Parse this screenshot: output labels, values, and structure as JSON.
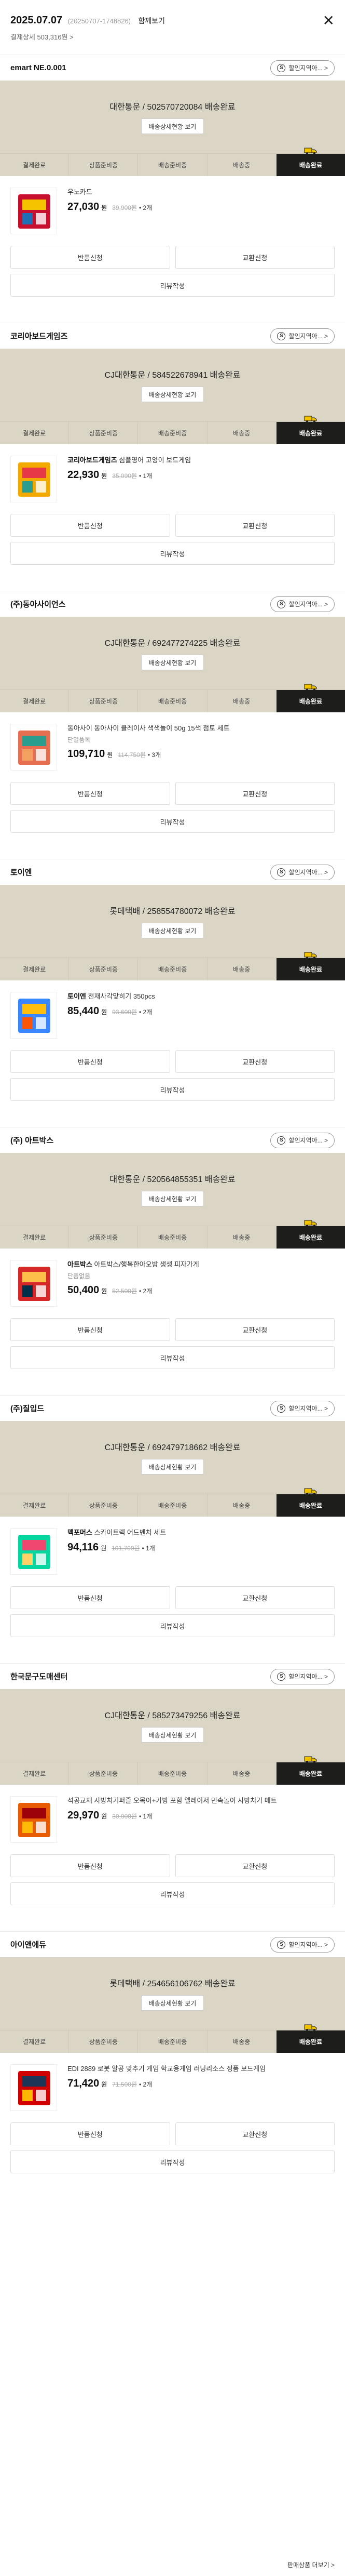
{
  "header": {
    "date": "2025.07.07",
    "order_no": "(20250707-1748826)",
    "all_link": "함께보기",
    "total": "결제상세 503,316원 >"
  },
  "steps": [
    "결제완료",
    "상품준비중",
    "배송준비중",
    "배송중",
    "배송완료"
  ],
  "ship_detail_label": "배송상세현황 보기",
  "return_label": "반품신청",
  "exchange_label": "교환신청",
  "review_label": "리뷰작성",
  "coupon_label": "할인지역아... >",
  "orders": [
    {
      "seller": "emart NE.0.001",
      "ship_status": "대한통운 / 502570720084 배송완료",
      "name_bold": "",
      "name": "우노카드",
      "option": "",
      "price": "27,030",
      "won": "원",
      "orig": "39,900원",
      "qty": "• 2개"
    },
    {
      "seller": "코리아보드게임즈",
      "ship_status": "CJ대한통운 / 584522678941 배송완료",
      "name_bold": "코리아보드게임즈",
      "name": " 심플영어 고양이 보드게임",
      "option": "",
      "price": "22,930",
      "won": "원",
      "orig": "35,090원",
      "qty": "• 1개"
    },
    {
      "seller": "(주)동아사이언스",
      "ship_status": "CJ대한통운 / 692477274225 배송완료",
      "name_bold": "",
      "name": "동아사이 동아사이 클레이사 색색놀이 50g 15색 점토 세트",
      "option": "단일품목",
      "price": "109,710",
      "won": "원",
      "orig": "114,750원",
      "qty": "• 3개"
    },
    {
      "seller": "토이엔",
      "ship_status": "롯데택배 / 258554780072 배송완료",
      "name_bold": "토이엔",
      "name": " 천재사각맞히기 350pcs",
      "option": "",
      "price": "85,440",
      "won": "원",
      "orig": "93,600원",
      "qty": "• 2개"
    },
    {
      "seller": "(주) 아트박스",
      "ship_status": "대한통운 / 520564855351 배송완료",
      "name_bold": "아트박스",
      "name": " 아트박스/행복한아오방 생생 피자가게",
      "option": "단품없음",
      "price": "50,400",
      "won": "원",
      "orig": "52,500원",
      "qty": "• 2개"
    },
    {
      "seller": "(주)질입드",
      "ship_status": "CJ대한통운 / 692479718662 배송완료",
      "name_bold": "맥포머스",
      "name": " 스카이트렉 어드벤처 세트",
      "option": "",
      "price": "94,116",
      "won": "원",
      "orig": "101,700원",
      "qty": "• 1개"
    },
    {
      "seller": "한국문구도매센터",
      "ship_status": "CJ대한통운 / 585273479256 배송완료",
      "name_bold": "",
      "name": "석공교재 사방치기퍼즐 오목이+가방 포함 엘레이저 민속놀이 사방치기 매트",
      "option": "",
      "price": "29,970",
      "won": "원",
      "orig": "30,000원",
      "qty": "• 1개"
    },
    {
      "seller": "아이앤에듀",
      "ship_status": "롯데택배 / 254656106762 배송완료",
      "name_bold": "",
      "name": "EDI 2889 로봇 알공 맞추기 게임 학교용게임 러닝리소스 정품 보드게임",
      "option": "",
      "price": "71,420",
      "won": "원",
      "orig": "71,500원",
      "qty": "• 2개"
    }
  ],
  "footer": {
    "more_label": "판매상품 더보기 >"
  }
}
